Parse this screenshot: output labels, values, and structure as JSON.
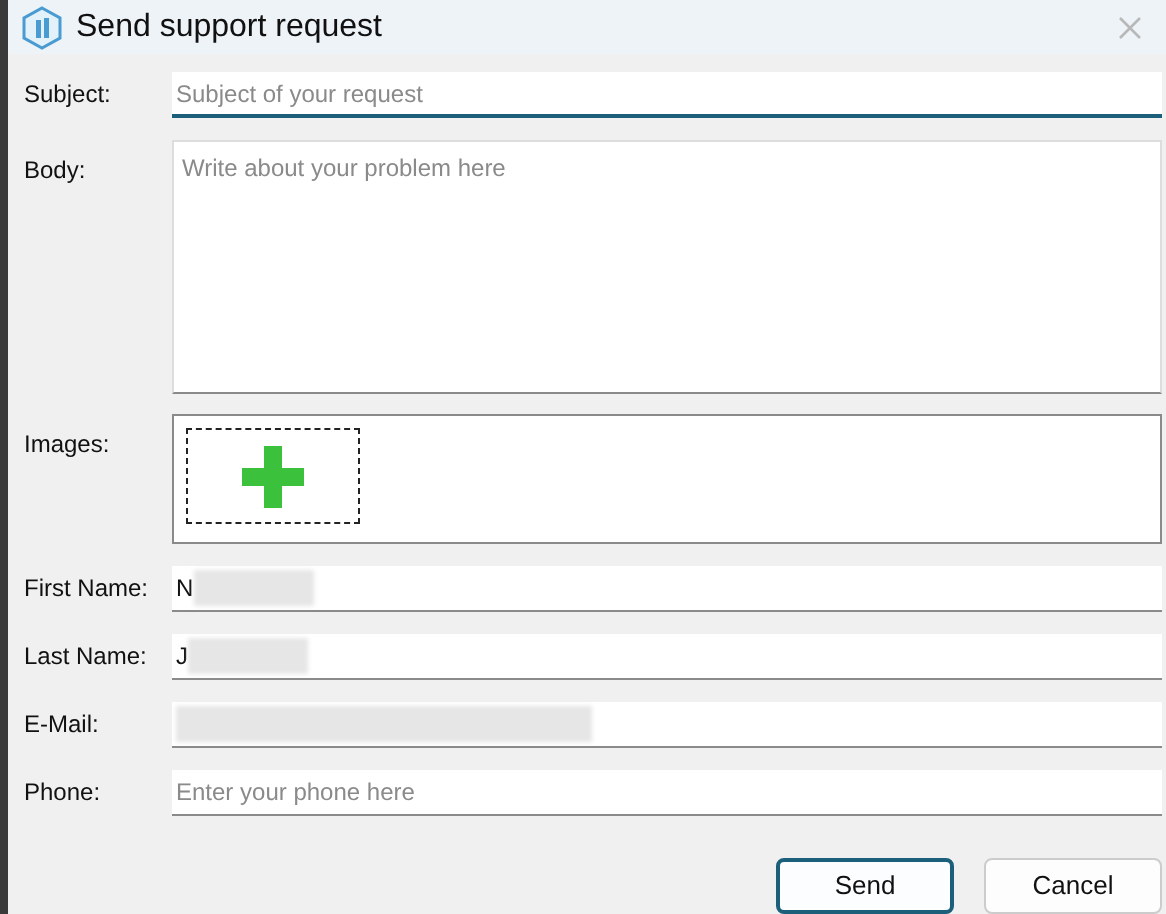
{
  "window": {
    "title": "Send support request"
  },
  "fields": [
    {
      "kind": "line",
      "label": "Subject:",
      "placeholder": "Subject of your request",
      "focused": true
    },
    {
      "kind": "area",
      "label": "Body:",
      "placeholder": "Write about your problem here",
      "focused": false
    },
    {
      "kind": "images",
      "label": "Images:"
    },
    {
      "kind": "line",
      "label": "First Name:",
      "value": "N",
      "redacted": true,
      "focused": false
    },
    {
      "kind": "line",
      "label": "Last Name:",
      "value": "J",
      "redacted": true,
      "focused": false
    },
    {
      "kind": "line",
      "label": "E-Mail:",
      "redacted": true,
      "focused": false
    },
    {
      "kind": "line",
      "label": "Phone:",
      "placeholder": "Enter your phone here",
      "focused": false
    }
  ],
  "buttons": [
    {
      "label": "Send",
      "default": true
    },
    {
      "label": "Cancel",
      "default": false
    }
  ]
}
